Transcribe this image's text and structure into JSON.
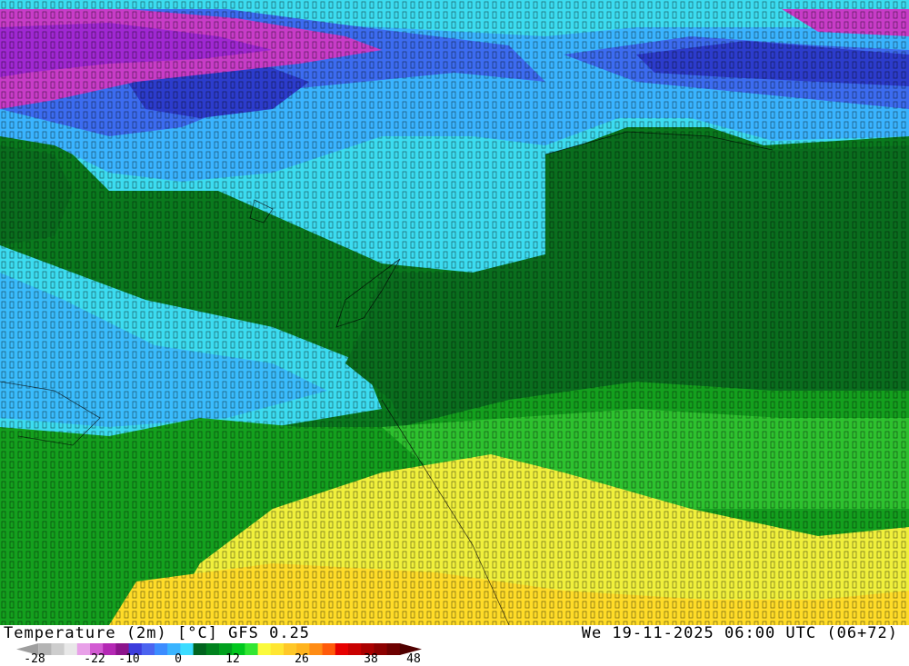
{
  "footer": {
    "title": "Temperature (2m) [°C] GFS 0.25",
    "datetime": "We 19-11-2025 06:00 UTC (06+72)"
  },
  "legend": {
    "ticks": [
      "-28",
      "-22",
      "-10",
      "0",
      "12",
      "26",
      "38",
      "48"
    ],
    "colors": [
      "#9e9e9e",
      "#b4b4b4",
      "#cdcdcd",
      "#e8e8e8",
      "#e8a0e8",
      "#d25ad2",
      "#b428b4",
      "#8c148c",
      "#3c3cdc",
      "#4b64f0",
      "#3c8cff",
      "#3ab4ff",
      "#3cdcff",
      "#00641e",
      "#00821e",
      "#00a01e",
      "#00c81e",
      "#32e632",
      "#fafa3c",
      "#ffe632",
      "#ffc828",
      "#ffb41e",
      "#ff8c14",
      "#ff5a0a",
      "#e60000",
      "#c80000",
      "#aa0000",
      "#8c0000",
      "#6e0000",
      "#500000"
    ]
  },
  "map": {
    "region": "Northern Europe / Scandinavia",
    "palette": {
      "green_dark": "#0a6e1e",
      "green": "#008c1e",
      "green_light": "#14a01e",
      "green_bright": "#32c832",
      "cyan": "#3cdcf0",
      "light_blue": "#3ab4ff",
      "blue": "#3c6cf0",
      "dark_blue": "#2c3ccc",
      "magenta": "#c83cc8",
      "violet": "#a028d2",
      "yellow": "#f0f03c",
      "yellow_orange": "#ffdc28",
      "border": "#000000"
    }
  }
}
